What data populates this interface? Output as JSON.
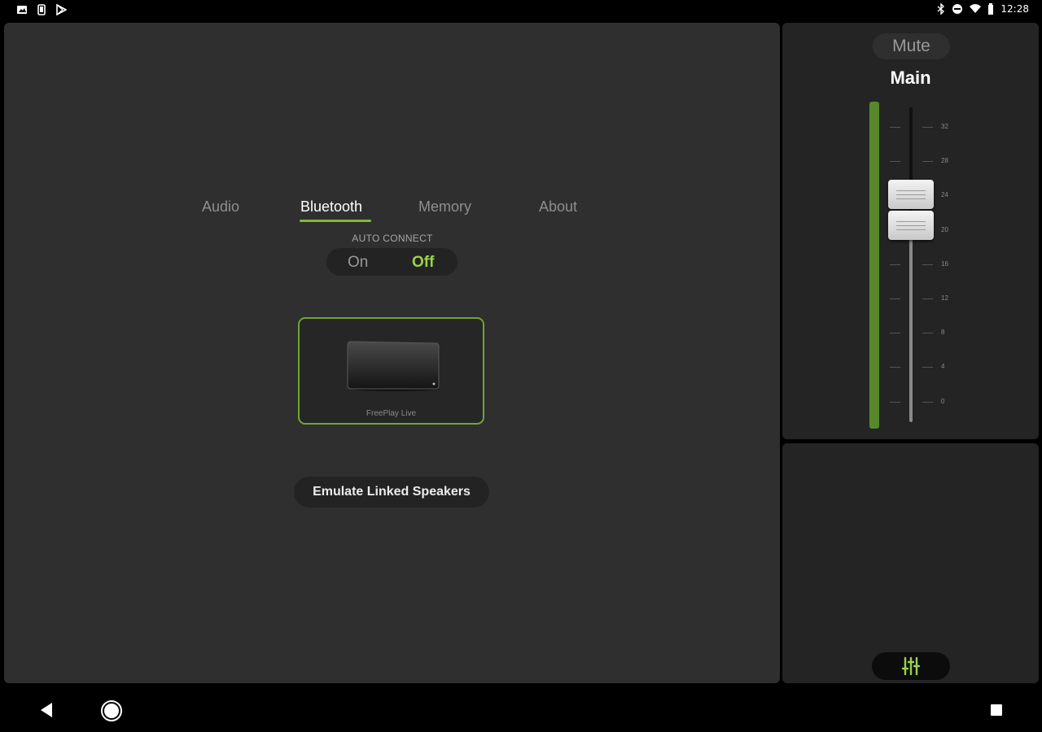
{
  "status_bar": {
    "time": "12:28",
    "left_icons": [
      "image-notification-icon",
      "phone-notification-icon",
      "play-store-icon"
    ],
    "right_icons": [
      "bluetooth-icon",
      "do-not-disturb-icon",
      "wifi-icon",
      "battery-icon"
    ]
  },
  "tabs": [
    {
      "label": "Audio",
      "active": false
    },
    {
      "label": "Bluetooth",
      "active": true
    },
    {
      "label": "Memory",
      "active": false
    },
    {
      "label": "About",
      "active": false
    }
  ],
  "auto_connect": {
    "label": "AUTO CONNECT",
    "on_label": "On",
    "off_label": "Off",
    "selected": "Off"
  },
  "speaker": {
    "name": "FreePlay Live",
    "selected": true
  },
  "emulate_button": {
    "label": "Emulate Linked Speakers"
  },
  "mixer": {
    "mute_label": "Mute",
    "channel_name": "Main",
    "scale_labels": [
      "32",
      "28",
      "24",
      "20",
      "16",
      "12",
      "8",
      "4",
      "0"
    ],
    "fader_value": 22,
    "level_fraction": 1.0
  },
  "colors": {
    "accent": "#9bd24a",
    "panel": "#2f2f2f",
    "side_panel": "#242424",
    "level_meter": "#57892b"
  },
  "nav": {
    "back_icon": "back-icon",
    "home_icon": "home-icon",
    "recents_icon": "recents-icon"
  }
}
